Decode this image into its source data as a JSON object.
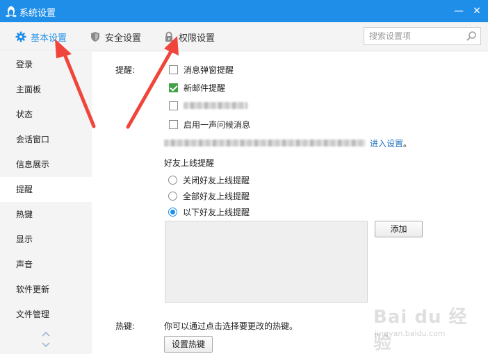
{
  "window": {
    "title": "系统设置",
    "minimize_glyph": "—",
    "close_glyph": "✕"
  },
  "tabs": [
    {
      "label": "基本设置",
      "icon": "gear-icon",
      "active": true
    },
    {
      "label": "安全设置",
      "icon": "shield-icon",
      "active": false
    },
    {
      "label": "权限设置",
      "icon": "lock-icon",
      "active": false
    }
  ],
  "search": {
    "placeholder": "搜索设置项",
    "value": ""
  },
  "sidebar": {
    "items": [
      {
        "label": "登录",
        "active": false
      },
      {
        "label": "主面板",
        "active": false
      },
      {
        "label": "状态",
        "active": false
      },
      {
        "label": "会话窗口",
        "active": false
      },
      {
        "label": "信息展示",
        "active": false
      },
      {
        "label": "提醒",
        "active": true
      },
      {
        "label": "热键",
        "active": false
      },
      {
        "label": "显示",
        "active": false
      },
      {
        "label": "声音",
        "active": false
      },
      {
        "label": "软件更新",
        "active": false
      },
      {
        "label": "文件管理",
        "active": false
      }
    ]
  },
  "reminder": {
    "section_label": "提醒:",
    "options": [
      {
        "label": "消息弹窗提醒",
        "checked": false
      },
      {
        "label": "新邮件提醒",
        "checked": true
      },
      {
        "label": "",
        "checked": false
      },
      {
        "label": "启用一声问候消息",
        "checked": false
      }
    ],
    "link_text": "进入设置",
    "link_suffix": "。"
  },
  "friend_online": {
    "title": "好友上线提醒",
    "options": [
      {
        "label": "关闭好友上线提醒",
        "selected": false
      },
      {
        "label": "全部好友上线提醒",
        "selected": false
      },
      {
        "label": "以下好友上线提醒",
        "selected": true
      }
    ],
    "add_button": "添加"
  },
  "hotkey": {
    "section_label": "热键:",
    "description": "你可以通过点击选择要更改的热键。",
    "button": "设置热键"
  },
  "colors": {
    "titlebar": "#1f8ee8",
    "accent": "#1f8ee8",
    "annotation_arrow": "#f0453a",
    "check_green": "#3fa345"
  },
  "watermark": {
    "main": "Bai du 经验",
    "sub": "jingyan.baidu.com"
  }
}
